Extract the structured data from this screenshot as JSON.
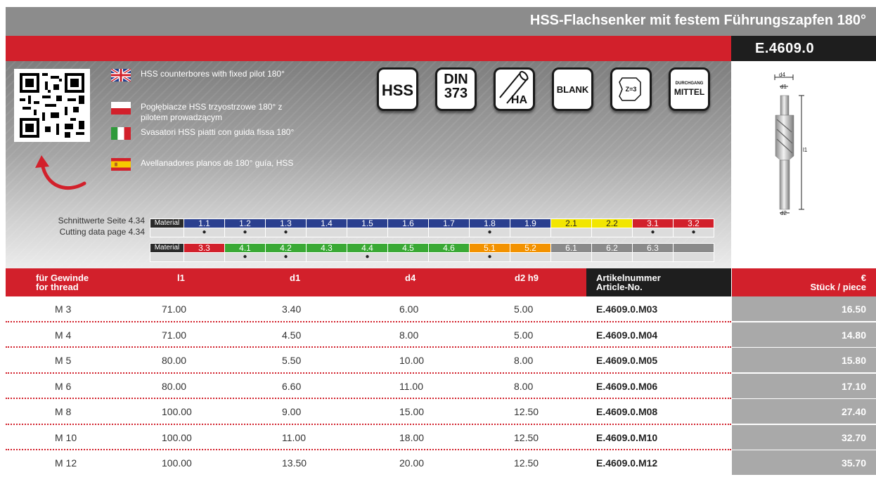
{
  "header": {
    "title": "HSS-Flachsenker mit festem Führungszapfen 180°",
    "code": "E.4609.0"
  },
  "languages": [
    {
      "flag": "uk-flag-icon",
      "text": "HSS counterbores with fixed pilot 180°"
    },
    {
      "flag": "poland-flag-icon",
      "text": "Pogłębiacze HSS trzyostrzowe 180°  z pilotem prowadzącym"
    },
    {
      "flag": "italy-flag-icon",
      "text": "Svasatori HSS piatti con guida fissa 180°"
    },
    {
      "flag": "spain-flag-icon",
      "text": "Avellanadores planos de 180° guía, HSS"
    }
  ],
  "icons": {
    "hss": "HSS",
    "din_line1": "DIN",
    "din_line2": "373",
    "ha": "HA",
    "blank": "BLANK",
    "z3": "Z=3",
    "dm_line1": "DURCHGANG",
    "dm_line2": "MITTEL"
  },
  "cutting": {
    "line1": "Schnittwerte Seite 4.34",
    "line2": "Cutting data page 4.34"
  },
  "material_label": "Material",
  "materials_row1": [
    {
      "code": "1.1",
      "color": "#2a3f8f",
      "dot": true
    },
    {
      "code": "1.2",
      "color": "#2a3f8f",
      "dot": true
    },
    {
      "code": "1.3",
      "color": "#2a3f8f",
      "dot": true
    },
    {
      "code": "1.4",
      "color": "#2a3f8f",
      "dot": false
    },
    {
      "code": "1.5",
      "color": "#2a3f8f",
      "dot": false
    },
    {
      "code": "1.6",
      "color": "#2a3f8f",
      "dot": false
    },
    {
      "code": "1.7",
      "color": "#2a3f8f",
      "dot": false
    },
    {
      "code": "1.8",
      "color": "#2a3f8f",
      "dot": true
    },
    {
      "code": "1.9",
      "color": "#2a3f8f",
      "dot": false
    },
    {
      "code": "2.1",
      "color": "#f2e600",
      "dot": false
    },
    {
      "code": "2.2",
      "color": "#f2e600",
      "dot": false
    },
    {
      "code": "3.1",
      "color": "#d2202b",
      "dot": true
    },
    {
      "code": "3.2",
      "color": "#d2202b",
      "dot": true
    }
  ],
  "materials_row2": [
    {
      "code": "3.3",
      "color": "#d2202b",
      "dot": false
    },
    {
      "code": "4.1",
      "color": "#3aa935",
      "dot": true
    },
    {
      "code": "4.2",
      "color": "#3aa935",
      "dot": true
    },
    {
      "code": "4.3",
      "color": "#3aa935",
      "dot": false
    },
    {
      "code": "4.4",
      "color": "#3aa935",
      "dot": true
    },
    {
      "code": "4.5",
      "color": "#3aa935",
      "dot": false
    },
    {
      "code": "4.6",
      "color": "#3aa935",
      "dot": false
    },
    {
      "code": "5.1",
      "color": "#f39200",
      "dot": true
    },
    {
      "code": "5.2",
      "color": "#f39200",
      "dot": false
    },
    {
      "code": "6.1",
      "color": "#8a8a8a",
      "dot": false
    },
    {
      "code": "6.2",
      "color": "#8a8a8a",
      "dot": false
    },
    {
      "code": "6.3",
      "color": "#8a8a8a",
      "dot": false
    },
    {
      "code": "",
      "color": "#8a8a8a",
      "dot": false
    }
  ],
  "dot_symbol": "●",
  "table": {
    "headers": {
      "thread_de": "für Gewinde",
      "thread_en": "for thread",
      "l1": "l1",
      "d1": "d1",
      "d4": "d4",
      "d2": "d2 h9",
      "art_de": "Artikelnummer",
      "art_en": "Article-No.",
      "price_sym": "€",
      "price_lbl": "Stück / piece"
    },
    "rows": [
      {
        "thread": "M 3",
        "l1": "71.00",
        "d1": "3.40",
        "d4": "6.00",
        "d2": "5.00",
        "article": "E.4609.0.M03",
        "price": "16.50"
      },
      {
        "thread": "M 4",
        "l1": "71.00",
        "d1": "4.50",
        "d4": "8.00",
        "d2": "5.00",
        "article": "E.4609.0.M04",
        "price": "14.80"
      },
      {
        "thread": "M 5",
        "l1": "80.00",
        "d1": "5.50",
        "d4": "10.00",
        "d2": "8.00",
        "article": "E.4609.0.M05",
        "price": "15.80"
      },
      {
        "thread": "M 6",
        "l1": "80.00",
        "d1": "6.60",
        "d4": "11.00",
        "d2": "8.00",
        "article": "E.4609.0.M06",
        "price": "17.10"
      },
      {
        "thread": "M 8",
        "l1": "100.00",
        "d1": "9.00",
        "d4": "15.00",
        "d2": "12.50",
        "article": "E.4609.0.M08",
        "price": "27.40"
      },
      {
        "thread": "M 10",
        "l1": "100.00",
        "d1": "11.00",
        "d4": "18.00",
        "d2": "12.50",
        "article": "E.4609.0.M10",
        "price": "32.70"
      },
      {
        "thread": "M 12",
        "l1": "100.00",
        "d1": "13.50",
        "d4": "20.00",
        "d2": "12.50",
        "article": "E.4609.0.M12",
        "price": "35.70"
      }
    ]
  },
  "drawing_labels": {
    "d4": "d4",
    "d1": "d1",
    "l1": "l1",
    "d2": "d2"
  }
}
